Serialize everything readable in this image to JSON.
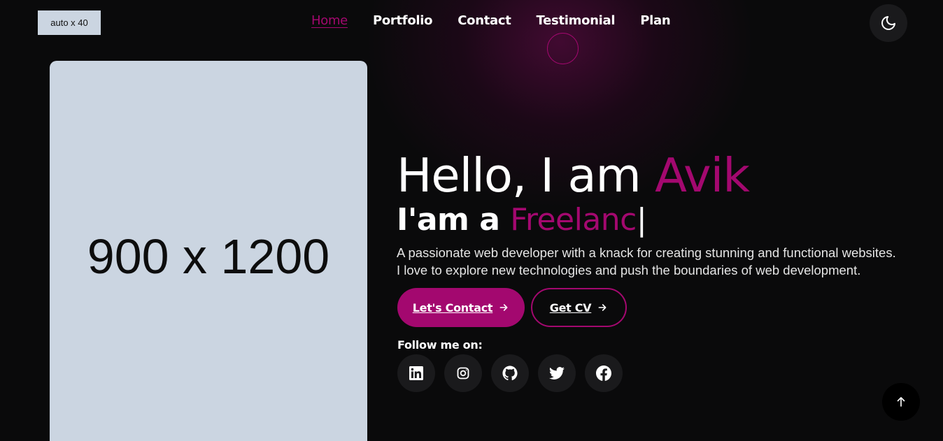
{
  "header": {
    "logo_placeholder": "auto x 40",
    "nav": [
      {
        "label": "Home",
        "active": true
      },
      {
        "label": "Portfolio",
        "active": false
      },
      {
        "label": "Contact",
        "active": false
      },
      {
        "label": "Testimonial",
        "active": false
      },
      {
        "label": "Plan",
        "active": false
      }
    ],
    "theme_toggle_icon": "moon-icon"
  },
  "hero": {
    "image_placeholder": "900 x 1200",
    "greeting": "Hello, I am",
    "name": "Avik",
    "role_prefix": "I'am a",
    "role_typed": "Freelanc",
    "role_caret": "|",
    "description": "A passionate web developer with a knack for creating stunning and functional websites. I love to explore new technologies and push the boundaries of web development.",
    "buttons": {
      "contact_label": "Let's Contact",
      "cv_label": "Get CV"
    },
    "follow_label": "Follow me on:",
    "socials": [
      "linkedin-icon",
      "instagram-icon",
      "github-icon",
      "twitter-icon",
      "facebook-icon"
    ]
  },
  "scroll_top_icon": "arrow-up-icon",
  "colors": {
    "accent": "#a3086f",
    "background": "#0a0a0b",
    "surface": "#1a1a1c",
    "placeholder": "#cbd5e1"
  }
}
